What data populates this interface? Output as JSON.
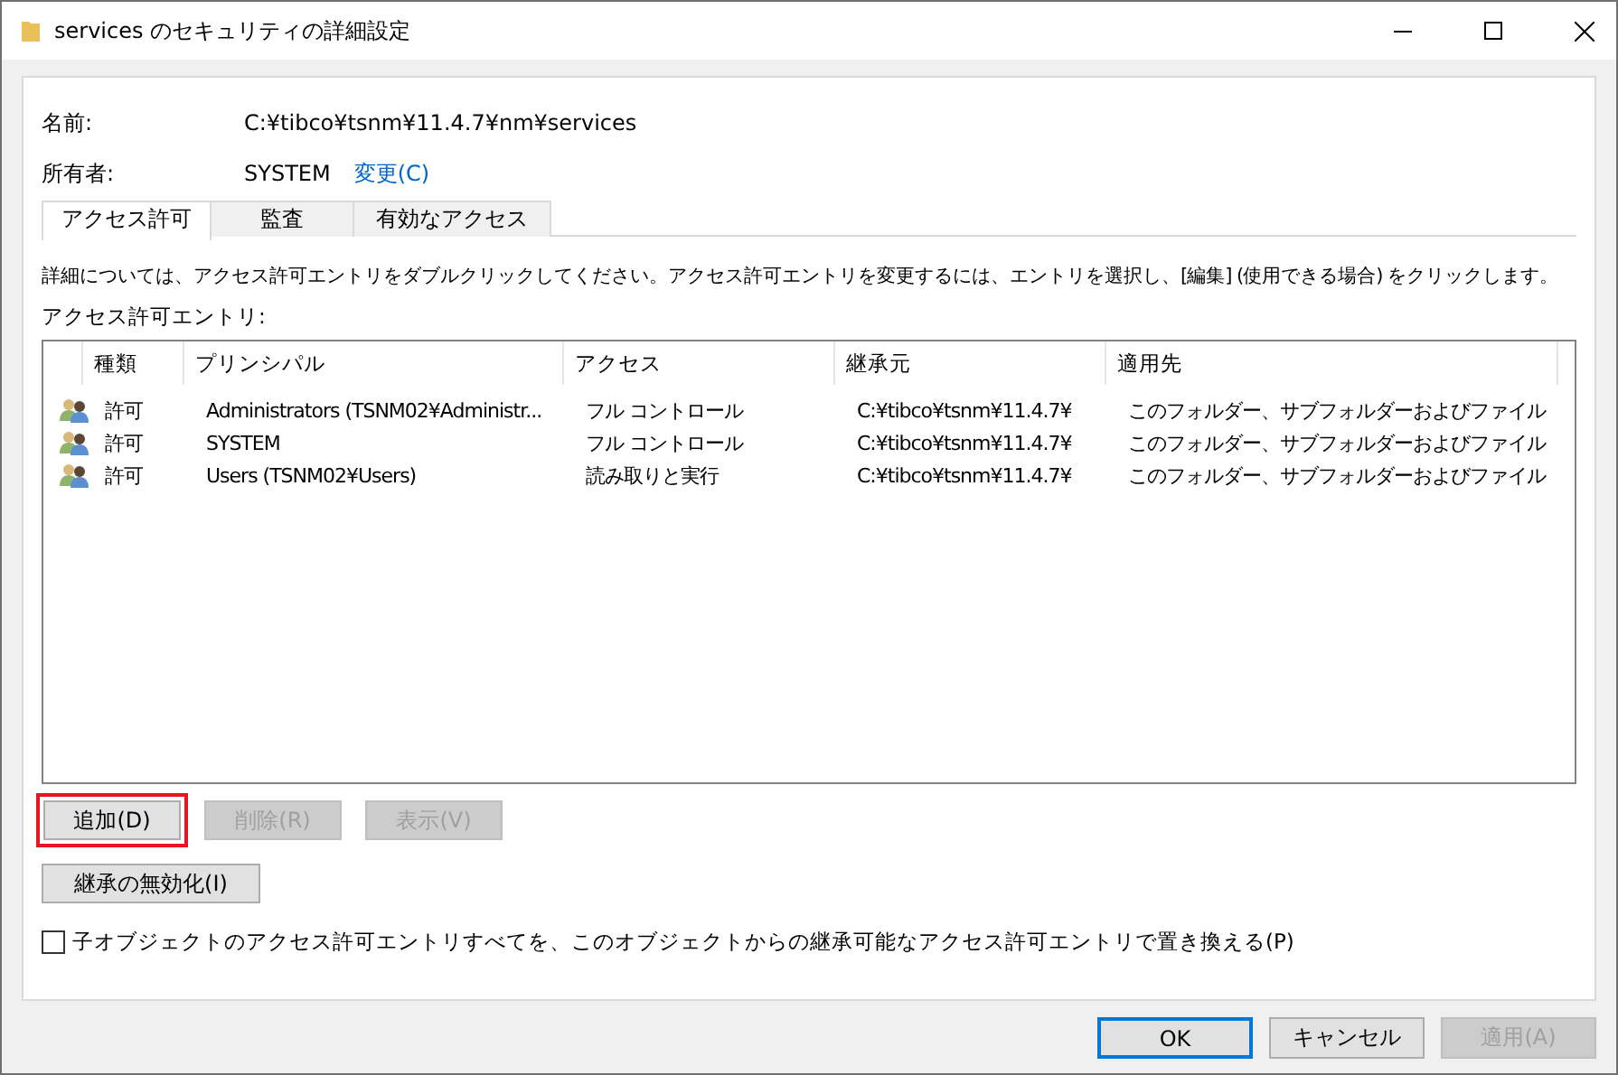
{
  "window": {
    "title": "services のセキュリティの詳細設定"
  },
  "name_field": {
    "label": "名前:",
    "value": "C:¥tibco¥tsnm¥11.4.7¥nm¥services"
  },
  "owner_field": {
    "label": "所有者:",
    "value": "SYSTEM",
    "link": "変更(C)"
  },
  "tabs": [
    {
      "label": "アクセス許可",
      "selected": true
    },
    {
      "label": "監査",
      "selected": false
    },
    {
      "label": "有効なアクセス",
      "selected": false
    }
  ],
  "description": "詳細については、アクセス許可エントリをダブルクリックしてください。アクセス許可エントリを変更するには、エントリを選択し、[編集] (使用できる場合) をクリックします。",
  "entries_label": "アクセス許可エントリ:",
  "table": {
    "columns": [
      "種類",
      "プリンシパル",
      "アクセス",
      "継承元",
      "適用先"
    ],
    "rows": [
      {
        "type": "許可",
        "principal": "Administrators (TSNM02¥Administr...",
        "access": "フル コントロール",
        "inherited_from": "C:¥tibco¥tsnm¥11.4.7¥",
        "applies_to": "このフォルダー、サブフォルダーおよびファイル"
      },
      {
        "type": "許可",
        "principal": "SYSTEM",
        "access": "フル コントロール",
        "inherited_from": "C:¥tibco¥tsnm¥11.4.7¥",
        "applies_to": "このフォルダー、サブフォルダーおよびファイル"
      },
      {
        "type": "許可",
        "principal": "Users (TSNM02¥Users)",
        "access": "読み取りと実行",
        "inherited_from": "C:¥tibco¥tsnm¥11.4.7¥",
        "applies_to": "このフォルダー、サブフォルダーおよびファイル"
      }
    ]
  },
  "entry_buttons": [
    {
      "label": "追加(D)",
      "disabled": false,
      "highlighted": true
    },
    {
      "label": "削除(R)",
      "disabled": true,
      "highlighted": false
    },
    {
      "label": "表示(V)",
      "disabled": true,
      "highlighted": false
    }
  ],
  "inherit_button": {
    "label": "継承の無効化(I)"
  },
  "replace_checkbox": {
    "label": "子オブジェクトのアクセス許可エントリすべてを、このオブジェクトからの継承可能なアクセス許可エントリで置き換える(P)",
    "checked": false
  },
  "dialog_buttons": [
    {
      "label": "OK",
      "default": true,
      "disabled": false
    },
    {
      "label": "キャンセル",
      "default": false,
      "disabled": false
    },
    {
      "label": "適用(A)",
      "default": false,
      "disabled": true
    }
  ]
}
